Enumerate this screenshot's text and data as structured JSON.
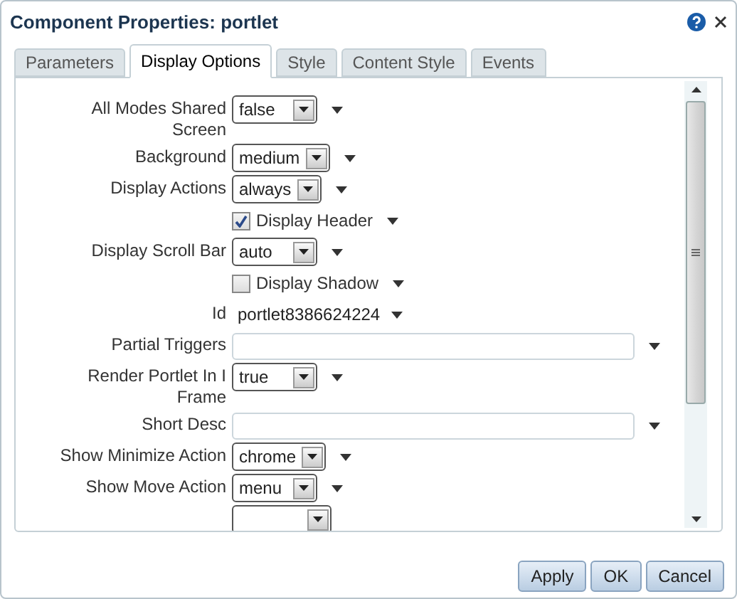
{
  "window": {
    "title": "Component Properties: portlet"
  },
  "tabs": [
    {
      "label": "Parameters",
      "selected": false
    },
    {
      "label": "Display Options",
      "selected": true
    },
    {
      "label": "Style",
      "selected": false
    },
    {
      "label": "Content Style",
      "selected": false
    },
    {
      "label": "Events",
      "selected": false
    }
  ],
  "properties": [
    {
      "kind": "select",
      "label": "All Modes Shared Screen",
      "value": "false"
    },
    {
      "kind": "select",
      "label": "Background",
      "value": "medium"
    },
    {
      "kind": "select",
      "label": "Display Actions",
      "value": "always"
    },
    {
      "kind": "checkbox",
      "label": "Display Header",
      "checked": true
    },
    {
      "kind": "select",
      "label": "Display Scroll Bar",
      "value": "auto"
    },
    {
      "kind": "checkbox",
      "label": "Display Shadow",
      "checked": false
    },
    {
      "kind": "text",
      "label": "Id",
      "value": "portlet8386624224"
    },
    {
      "kind": "field",
      "label": "Partial Triggers"
    },
    {
      "kind": "select",
      "label": "Render Portlet In I Frame",
      "value": "true"
    },
    {
      "kind": "field",
      "label": "Short Desc"
    },
    {
      "kind": "select",
      "label": "Show Minimize Action",
      "value": "chrome"
    },
    {
      "kind": "select",
      "label": "Show Move Action",
      "value": "menu"
    },
    {
      "kind": "select"
    }
  ],
  "buttons": [
    "Apply",
    "OK",
    "Cancel"
  ]
}
